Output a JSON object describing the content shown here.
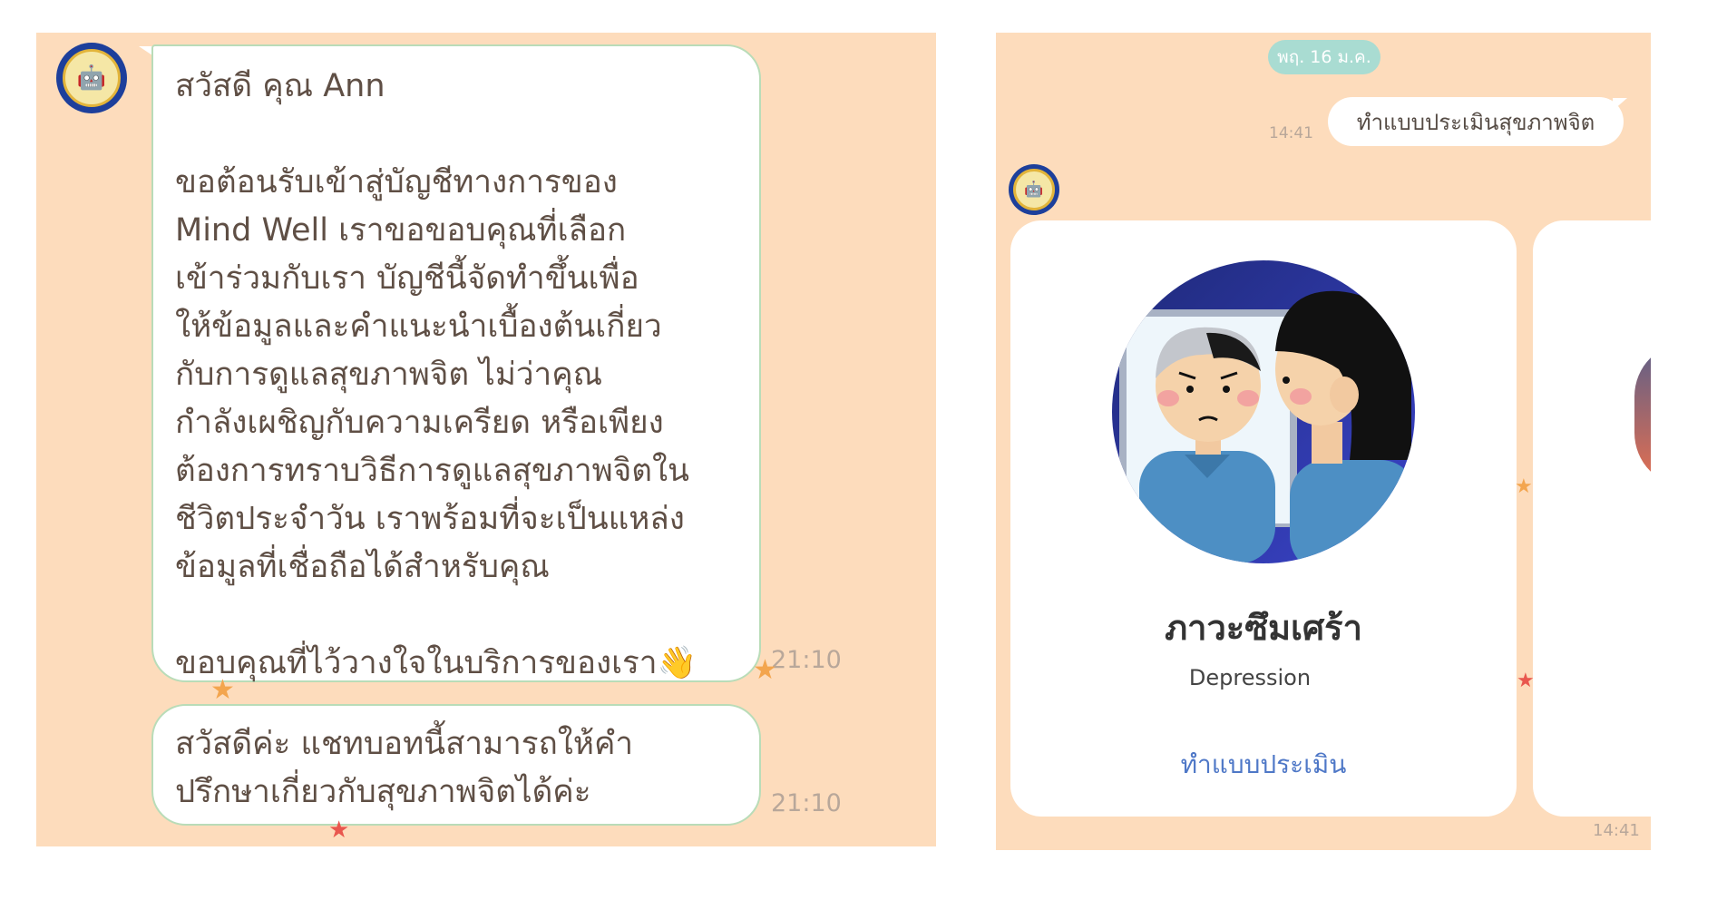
{
  "left_chat": {
    "welcome_message": "สวัสดี คุณ Ann\n\nขอต้อนรับเข้าสู่บัญชีทางการของ\nMind Well เราขอขอบคุณที่เลือก\nเข้าร่วมกับเรา บัญชีนี้จัดทำขึ้นเพื่อ\nให้ข้อมูลและคำแนะนำเบื้องต้นเกี่ยว\nกับการดูแลสุขภาพจิต ไม่ว่าคุณ\nกำลังเผชิญกับความเครียด หรือเพียง\nต้องการทราบวิธีการดูแลสุขภาพจิตใน\nชีวิตประจำวัน เราพร้อมที่จะเป็นแหล่ง\nข้อมูลที่เชื่อถือได้สำหรับคุณ\n\nขอบคุณที่ไว้วางใจในบริการของเรา👋",
    "welcome_time": "21:10",
    "greet_message": "สวัสดีค่ะ แชทบอทนี้สามารถให้คำ\nปรึกษาเกี่ยวกับสุขภาพจิตได้ค่ะ",
    "greet_time": "21:10",
    "avatar_icon": "robot-logo-icon"
  },
  "right_chat": {
    "date_chip": "พฤ. 16 ม.ค.",
    "user_message": "ทำแบบประเมินสุขภาพจิต",
    "user_message_time": "14:41",
    "card": {
      "title": "ภาวะซึมเศร้า",
      "subtitle": "Depression",
      "action_label": "ทำแบบประเมิน",
      "illustration": "person-looking-in-mirror-illustration"
    },
    "card_time": "14:41",
    "avatar_icon": "robot-logo-icon"
  },
  "colors": {
    "chat_background": "#fddcbc",
    "bubble_border": "#b9dcb8",
    "link_blue": "#4f78c7",
    "date_chip": "#a9dcd2"
  }
}
